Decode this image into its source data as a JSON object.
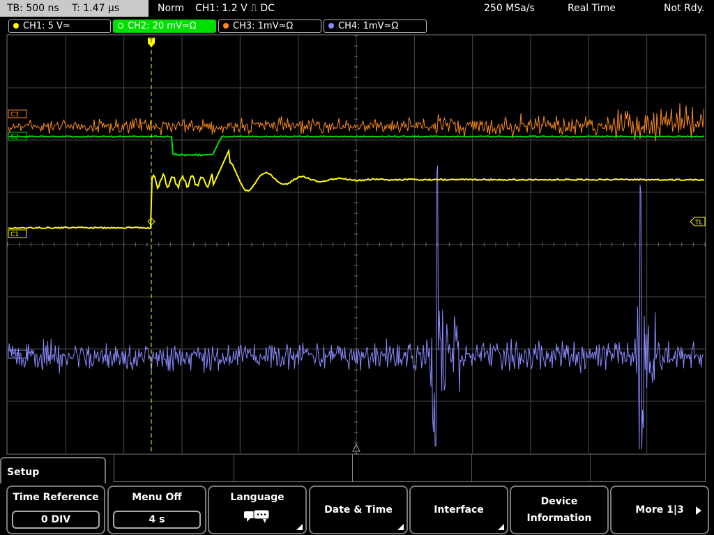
{
  "topbar": {
    "timebase": "TB: 500 ns",
    "trigger_time": "T: 1.47 µs",
    "mode": "Norm",
    "trigger_info": "CH1: 1.2 V ⎍ DC",
    "sample_rate": "250 MSa/s",
    "acq_mode": "Real Time",
    "status": "Not Rdy."
  },
  "channels": [
    {
      "label": "CH1: 5 V≃",
      "color": "#ffff00",
      "active": false
    },
    {
      "label": "CH2: 20 mV≃Ω",
      "color": "#00e000",
      "active": true
    },
    {
      "label": "CH3: 1mV≃Ω",
      "color": "#ff8c1a",
      "active": false
    },
    {
      "label": "CH4: 1mV≃Ω",
      "color": "#8a8aff",
      "active": false
    }
  ],
  "markers": {
    "ch3": "C3",
    "ch2": "C2",
    "ch1": "C1",
    "ch4": "C4",
    "trigger_level": "TL",
    "trigger_pos": "T"
  },
  "setup": {
    "title": "Setup"
  },
  "softkeys": {
    "time_reference": {
      "label": "Time Reference",
      "value": "0 DIV"
    },
    "menu_off": {
      "label": "Menu Off",
      "value": "4 s"
    },
    "language": {
      "label": "Language",
      "icon": "speech-bubbles-icon"
    },
    "date_time": {
      "label": "Date & Time"
    },
    "interface": {
      "label": "Interface"
    },
    "device_info": {
      "line1": "Device",
      "line2": "Information"
    },
    "more": {
      "label": "More 1|3"
    }
  },
  "colors": {
    "ch1": "#ffff00",
    "ch2": "#00e000",
    "ch3": "#ff8c1a",
    "ch4": "#8a8aff",
    "grid": "#5a5a5a",
    "topbar_box": "#c9c9c9",
    "active_tab": "#00e000"
  }
}
